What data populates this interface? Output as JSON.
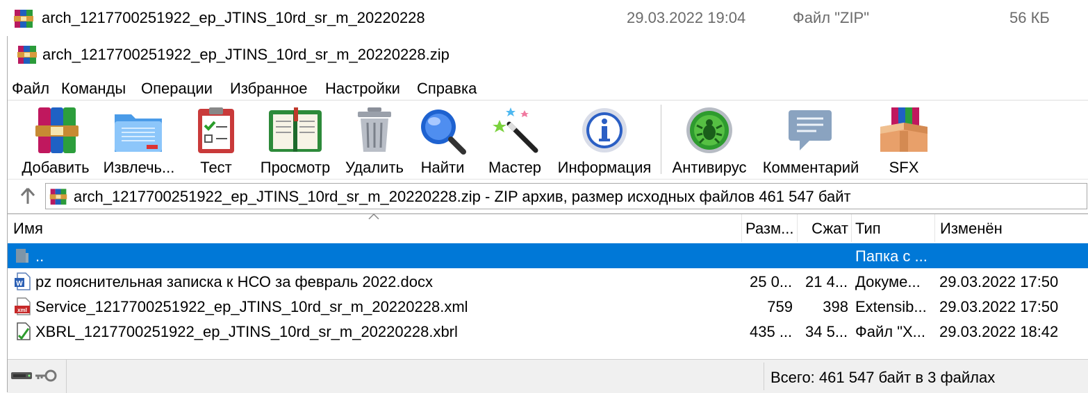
{
  "explorer_row": {
    "name": "arch_1217700251922_ep_JTINS_10rd_sr_m_20220228",
    "date": "29.03.2022 19:04",
    "type": "Файл \"ZIP\"",
    "size": "56 КБ"
  },
  "window": {
    "title": "arch_1217700251922_ep_JTINS_10rd_sr_m_20220228.zip"
  },
  "menu": [
    "Файл",
    "Команды",
    "Операции",
    "Избранное",
    "Настройки",
    "Справка"
  ],
  "toolbar": {
    "add": "Добавить",
    "extract": "Извлечь...",
    "test": "Тест",
    "view": "Просмотр",
    "delete": "Удалить",
    "find": "Найти",
    "wizard": "Мастер",
    "info": "Информация",
    "antivirus": "Антивирус",
    "comment": "Комментарий",
    "sfx": "SFX"
  },
  "address": {
    "text": "arch_1217700251922_ep_JTINS_10rd_sr_m_20220228.zip - ZIP архив, размер исходных файлов 461 547 байт"
  },
  "columns": {
    "name": "Имя",
    "size": "Разм...",
    "packed": "Сжат",
    "type": "Тип",
    "modified": "Изменён"
  },
  "files": [
    {
      "name": "..",
      "size": "",
      "packed": "",
      "type": "Папка с ...",
      "modified": "",
      "icon": "folder-up-icon",
      "selected": true
    },
    {
      "name": "pz пояснительная записка к НСО за февраль 2022.docx",
      "size": "25 0...",
      "packed": "21 4...",
      "type": "Докуме...",
      "modified": "29.03.2022 17:50",
      "icon": "word-doc-icon"
    },
    {
      "name": "Service_1217700251922_ep_JTINS_10rd_sr_m_20220228.xml",
      "size": "759",
      "packed": "398",
      "type": "Extensib...",
      "modified": "29.03.2022 17:50",
      "icon": "xml-file-icon"
    },
    {
      "name": "XBRL_1217700251922_ep_JTINS_10rd_sr_m_20220228.xbrl",
      "size": "435 ...",
      "packed": "34 5...",
      "type": "Файл \"X...",
      "modified": "29.03.2022 18:42",
      "icon": "xbrl-file-icon"
    }
  ],
  "status": {
    "text": "Всего: 461 547 байт в 3 файлах"
  },
  "colors": {
    "selection": "#0078d7",
    "statusbar": "#f0f0f0"
  }
}
